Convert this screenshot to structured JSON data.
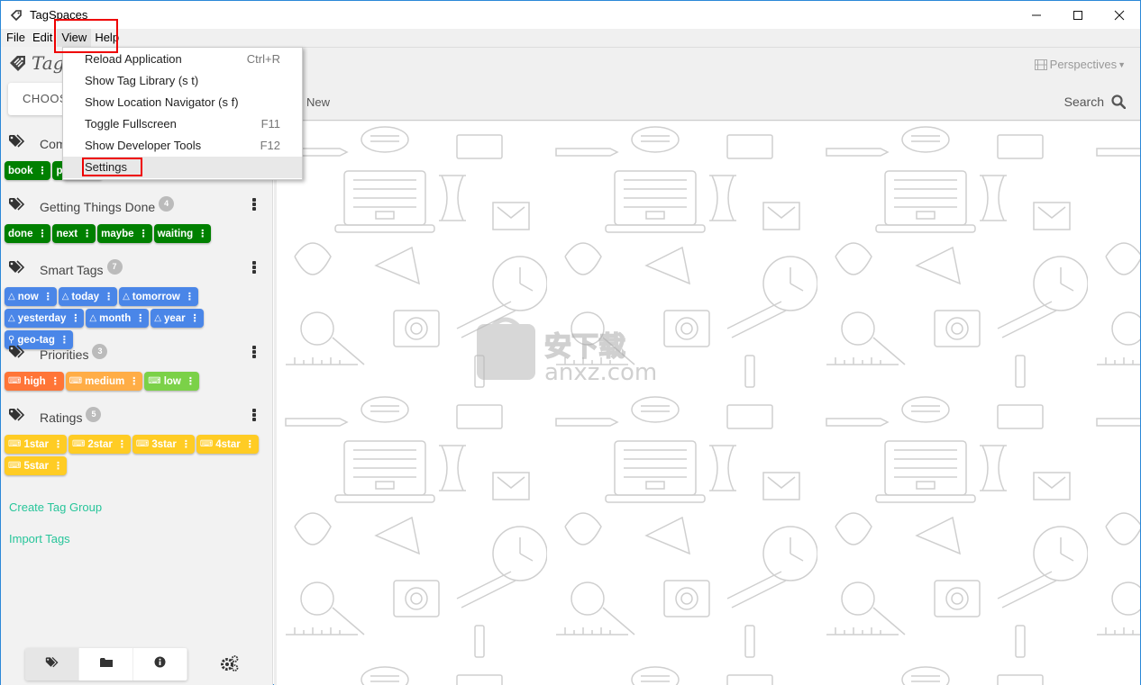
{
  "window": {
    "title": "TagSpaces",
    "controls": [
      "minimize",
      "maximize",
      "close"
    ]
  },
  "menubar": {
    "items": [
      {
        "label": "File"
      },
      {
        "label": "Edit"
      },
      {
        "label": "View",
        "active": true
      },
      {
        "label": "Help"
      }
    ]
  },
  "view_menu": {
    "items": [
      {
        "label": "Reload Application",
        "shortcut": "Ctrl+R"
      },
      {
        "label": "Show Tag Library (s t)",
        "shortcut": ""
      },
      {
        "label": "Show Location Navigator (s f)",
        "shortcut": ""
      },
      {
        "label": "Toggle Fullscreen",
        "shortcut": "F11"
      },
      {
        "label": "Show Developer Tools",
        "shortcut": "F12"
      },
      {
        "label": "Settings",
        "shortcut": "",
        "hovered": true
      }
    ]
  },
  "sidebar": {
    "logo_text": "TagSpaces",
    "choose_location": "CHOOSE LOCATION",
    "tag_groups": [
      {
        "title": "Common Tags",
        "count": "",
        "color": "#008000",
        "tags": [
          {
            "label": "book"
          },
          {
            "label": "paper"
          }
        ]
      },
      {
        "title": "Getting Things Done",
        "count": "4",
        "color": "#008000",
        "tags": [
          {
            "label": "done"
          },
          {
            "label": "next"
          },
          {
            "label": "maybe"
          },
          {
            "label": "waiting"
          }
        ]
      },
      {
        "title": "Smart Tags",
        "count": "7",
        "color": "#4a86e8",
        "tags": [
          {
            "label": "now",
            "icon": "flask-icon"
          },
          {
            "label": "today",
            "icon": "flask-icon"
          },
          {
            "label": "tomorrow",
            "icon": "flask-icon"
          },
          {
            "label": "yesterday",
            "icon": "flask-icon"
          },
          {
            "label": "month",
            "icon": "flask-icon"
          },
          {
            "label": "year",
            "icon": "flask-icon"
          },
          {
            "label": "geo-tag",
            "icon": "map-marker-icon"
          }
        ]
      },
      {
        "title": "Priorities",
        "count": "3",
        "tags": [
          {
            "label": "high",
            "icon": "keyboard-icon",
            "color": "#ff7537"
          },
          {
            "label": "medium",
            "icon": "keyboard-icon",
            "color": "#ffad46"
          },
          {
            "label": "low",
            "icon": "keyboard-icon",
            "color": "#7bd148"
          }
        ]
      },
      {
        "title": "Ratings",
        "count": "5",
        "color": "#ffcc24",
        "tags": [
          {
            "label": "1star",
            "icon": "keyboard-icon"
          },
          {
            "label": "2star",
            "icon": "keyboard-icon"
          },
          {
            "label": "3star",
            "icon": "keyboard-icon"
          },
          {
            "label": "4star",
            "icon": "keyboard-icon"
          },
          {
            "label": "5star",
            "icon": "keyboard-icon"
          }
        ]
      }
    ],
    "create_tag_group": "Create Tag Group",
    "import_tags": "Import Tags",
    "bottom_tabs": [
      {
        "icon": "tags-icon",
        "active": true
      },
      {
        "icon": "folder-icon",
        "active": false
      },
      {
        "icon": "info-icon",
        "active": false
      }
    ],
    "settings_icon": "cogs-icon"
  },
  "main": {
    "perspectives_label": "Perspectives",
    "new_label": "New",
    "search_label": "Search",
    "watermark_text": "anxz.com"
  }
}
